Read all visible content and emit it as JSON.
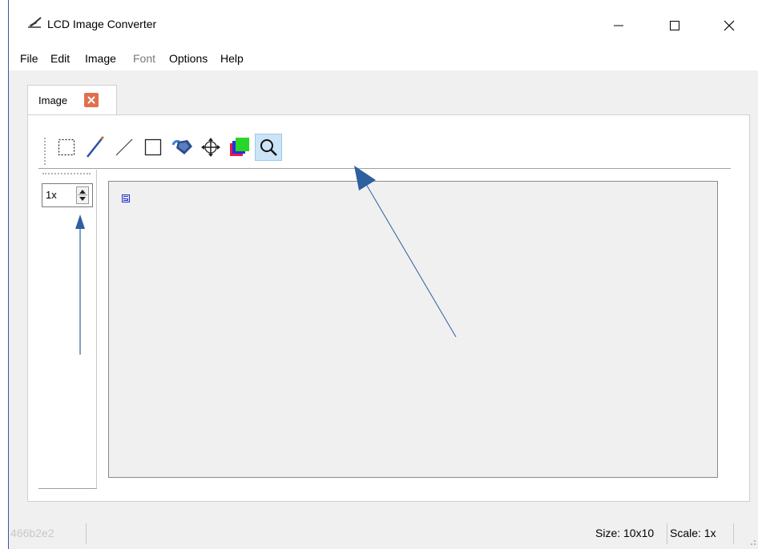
{
  "window": {
    "title": "LCD Image Converter",
    "controls": [
      "minimize",
      "maximize",
      "close"
    ]
  },
  "menu": {
    "items": [
      {
        "label": "File",
        "enabled": true
      },
      {
        "label": "Edit",
        "enabled": true
      },
      {
        "label": "Image",
        "enabled": true
      },
      {
        "label": "Font",
        "enabled": false
      },
      {
        "label": "Options",
        "enabled": true
      },
      {
        "label": "Help",
        "enabled": true
      }
    ]
  },
  "tab": {
    "label": "Image",
    "close_icon": "close-icon"
  },
  "toolbar": {
    "tools": [
      {
        "name": "rect-select-icon",
        "active": false
      },
      {
        "name": "pen-icon",
        "active": false
      },
      {
        "name": "line-icon",
        "active": false
      },
      {
        "name": "rectangle-icon",
        "active": false
      },
      {
        "name": "fill-bucket-icon",
        "active": false
      },
      {
        "name": "move-icon",
        "active": false
      },
      {
        "name": "color-swap-icon",
        "active": false
      },
      {
        "name": "zoom-icon",
        "active": true
      }
    ]
  },
  "scale_spinner": {
    "value": "1x"
  },
  "status": {
    "left_text": "466b2e2",
    "size": "Size: 10x10",
    "scale": "Scale: 1x"
  },
  "annotations": {
    "arrow_color": "#2e5f9e"
  },
  "colors": {
    "accent": "#2e5f9e",
    "tab_close": "#e0704c",
    "active_tool_bg": "#cce4f7"
  }
}
